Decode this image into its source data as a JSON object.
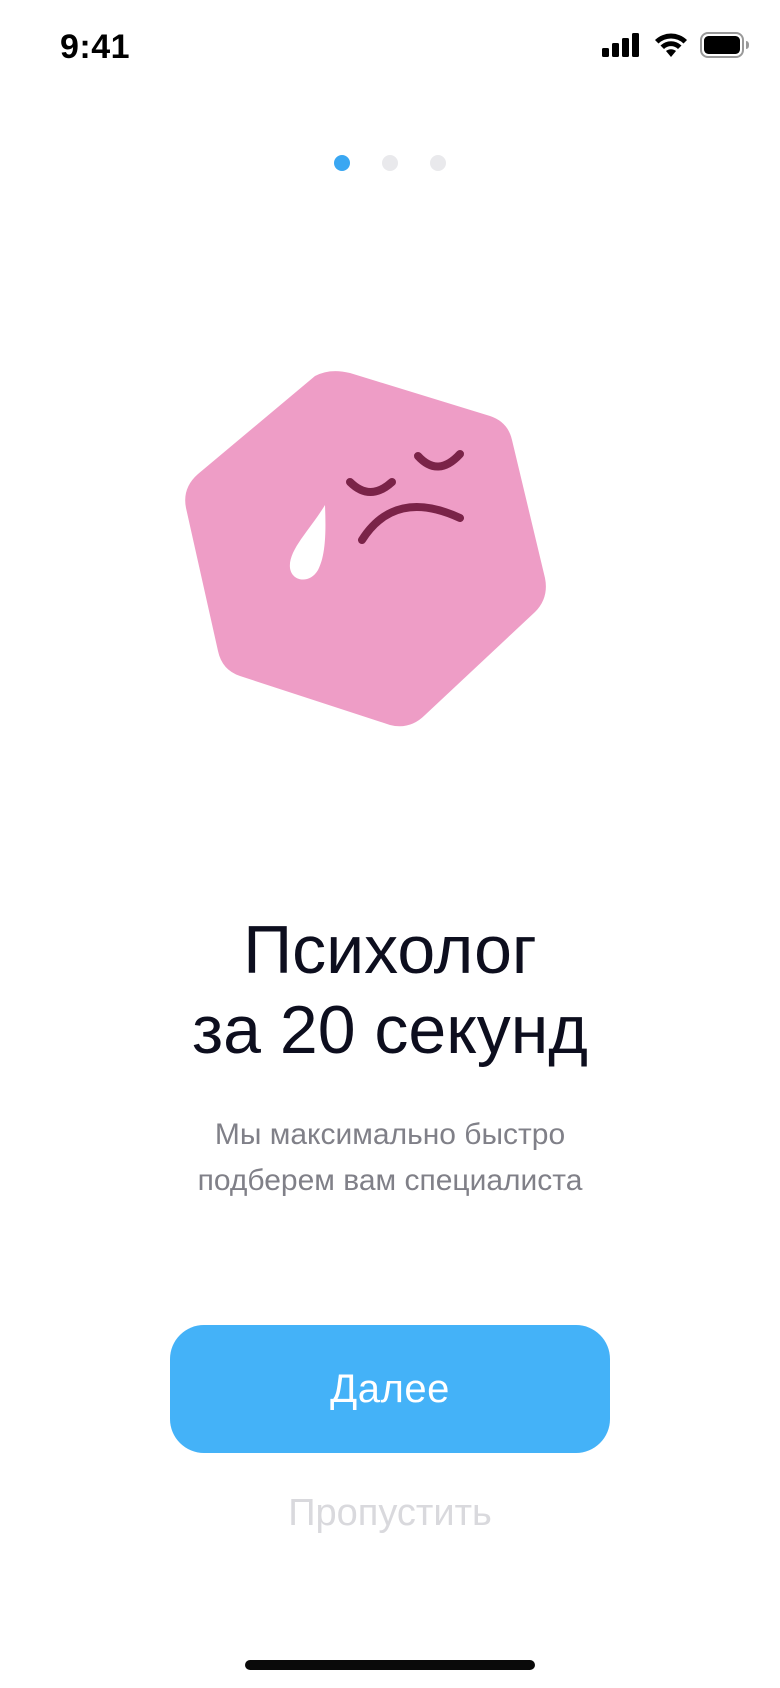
{
  "status_bar": {
    "time": "9:41",
    "icons": [
      "signal-icon",
      "wifi-icon",
      "battery-icon"
    ]
  },
  "pager": {
    "total": 3,
    "active_index": 0,
    "active_color": "#3aa7f2",
    "inactive_color": "#e9e9ec"
  },
  "illustration": {
    "icon": "sad-crying-hexagon-icon",
    "fill_color": "#ee9dc6",
    "face_color": "#7a2348",
    "tear_color": "#ffffff"
  },
  "onboarding": {
    "title_line1": "Психолог",
    "title_line2": "за 20 секунд",
    "subtitle_line1": "Мы максимально быстро",
    "subtitle_line2": "подберем вам специалиста"
  },
  "actions": {
    "next_label": "Далее",
    "next_color": "#44b2f8",
    "skip_label": "Пропустить"
  }
}
